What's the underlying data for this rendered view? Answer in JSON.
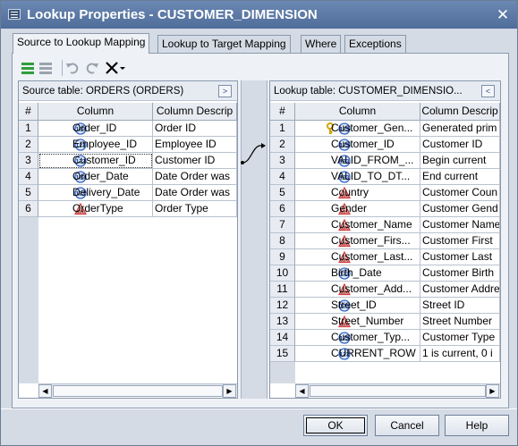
{
  "window": {
    "title": "Lookup Properties - CUSTOMER_DIMENSION",
    "close_symbol": "✕"
  },
  "tabs": [
    {
      "label": "Source to Lookup Mapping",
      "active": true
    },
    {
      "label": "Lookup to Target Mapping",
      "active": false
    },
    {
      "label": "Where",
      "active": false
    },
    {
      "label": "Exceptions",
      "active": false
    }
  ],
  "toolbar": {
    "icons": [
      "map-all-icon",
      "unmap-all-icon",
      "undo-icon",
      "redo-icon",
      "delete-icon",
      "dropdown-arrow-icon"
    ]
  },
  "source_panel": {
    "title": "Source table: ORDERS (ORDERS)",
    "columns": [
      "#",
      "Column",
      "Column Descrip"
    ],
    "rows": [
      {
        "num": "1",
        "type": "numeric",
        "name": "Order_ID",
        "desc": "Order ID"
      },
      {
        "num": "2",
        "type": "numeric",
        "name": "Employee_ID",
        "desc": "Employee ID"
      },
      {
        "num": "3",
        "type": "numeric",
        "name": "Customer_ID",
        "desc": "Customer ID"
      },
      {
        "num": "4",
        "type": "numeric",
        "name": "Order_Date",
        "desc": "Date Order was"
      },
      {
        "num": "5",
        "type": "numeric",
        "name": "Delivery_Date",
        "desc": "Date Order was"
      },
      {
        "num": "6",
        "type": "character",
        "name": "OrderType",
        "desc": "Order Type"
      }
    ]
  },
  "lookup_panel": {
    "title": "Lookup table: CUSTOMER_DIMENSIO...",
    "columns": [
      "#",
      "Column",
      "Column Descrip"
    ],
    "rows": [
      {
        "num": "1",
        "type": "numeric",
        "key": true,
        "name": "Customer_Gen...",
        "desc": "Generated prim"
      },
      {
        "num": "2",
        "type": "numeric",
        "name": "Customer_ID",
        "desc": "Customer ID"
      },
      {
        "num": "3",
        "type": "numeric",
        "name": "VALID_FROM_...",
        "desc": "Begin current"
      },
      {
        "num": "4",
        "type": "numeric",
        "name": "VALID_TO_DT...",
        "desc": "End current"
      },
      {
        "num": "5",
        "type": "character",
        "name": "Country",
        "desc": "Customer Coun"
      },
      {
        "num": "6",
        "type": "character",
        "name": "Gender",
        "desc": "Customer Gend"
      },
      {
        "num": "7",
        "type": "character",
        "name": "Customer_Name",
        "desc": "Customer Name"
      },
      {
        "num": "8",
        "type": "character",
        "name": "Customer_Firs...",
        "desc": "Customer First"
      },
      {
        "num": "9",
        "type": "character",
        "name": "Customer_Last...",
        "desc": "Customer Last"
      },
      {
        "num": "10",
        "type": "numeric",
        "name": "Birth_Date",
        "desc": "Customer Birth"
      },
      {
        "num": "11",
        "type": "character",
        "name": "Customer_Add...",
        "desc": "Customer Addre"
      },
      {
        "num": "12",
        "type": "numeric",
        "name": "Street_ID",
        "desc": "Street ID"
      },
      {
        "num": "13",
        "type": "character",
        "name": "Street_Number",
        "desc": "Street Number"
      },
      {
        "num": "14",
        "type": "numeric",
        "name": "Customer_Typ...",
        "desc": "Customer Type"
      },
      {
        "num": "15",
        "type": "numeric",
        "name": "CURRENT_ROW",
        "desc": "1 is current, 0 i"
      }
    ]
  },
  "mapping": {
    "from": "Customer_ID",
    "to": "Customer_Gen..."
  },
  "buttons": {
    "ok": "OK",
    "cancel": "Cancel",
    "help": "Help"
  },
  "colors": {
    "title_bar": "#5a77a3",
    "numeric_icon": "#3566c7",
    "character_icon": "#d23c3c",
    "key_icon": "#d4a400"
  }
}
